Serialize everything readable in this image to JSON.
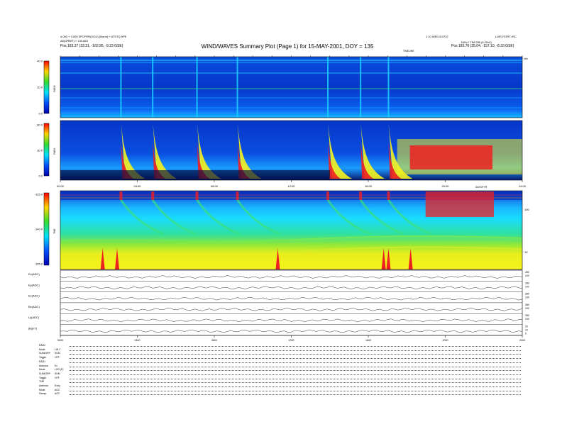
{
  "header": {
    "title": "WIND/WAVES Summary Plot (Page 1) for 15-MAY-2001, DOY = 135",
    "left_line1": "4.000 + 3.000 SPCPER(GCU) (Norm) + ATSTQ 5PE",
    "left_line2": "A5(ORBIT) = 130.663",
    "left_pos": "Pos    183.27 (33.31, -162.95, -9.23 GSE)",
    "right_line1": "1.10 WED 8.0722",
    "right_line2": "L0/EXTORT=RC",
    "right_line3": "DAILY TIM 285 (6.20x0)",
    "right_pos": "Pos    185.76 (35.04, -157.10, -8.33 GSE)",
    "timeline_label": "TIMELINE"
  },
  "panels": {
    "rad2_label": "RAD2",
    "rad1_label": "RAD1",
    "tnr_label": "TNR",
    "khz_label": "kHz",
    "rad2_ticks": [
      "40.0",
      "20.0",
      "0.0"
    ],
    "rad1_ticks": [
      "60.0",
      "30.0",
      "0.0"
    ],
    "tnr_ticks": [
      "-125.0",
      "-140.0",
      "-155.0"
    ],
    "tnr_right_ticks": [
      "100",
      "10"
    ],
    "dayofyr_label": "DAYOFYR",
    "time_ticks_top": [
      "00:00",
      "04:00",
      "08:00",
      "12:00",
      "16:00",
      "20:00",
      "24:00"
    ],
    "time_ticks_bottom": [
      "0000",
      "0400",
      "0800",
      "1200",
      "1600",
      "2000",
      "2400"
    ]
  },
  "traces": [
    {
      "label": "Ex(ADC)",
      "right": [
        "280",
        "100"
      ]
    },
    {
      "label": "Ey(ADC)",
      "right": [
        "280",
        "100"
      ]
    },
    {
      "label": "Ez(ADC)",
      "right": [
        "280",
        "100"
      ]
    },
    {
      "label": "Bx(ADC)",
      "right": [
        "280",
        "100"
      ]
    },
    {
      "label": "Ly(ADC)",
      "right": [
        "280",
        "100"
      ]
    },
    {
      "label": "|B|(nT)",
      "right": [
        "20",
        "10",
        "0"
      ]
    }
  ],
  "bottom_info": [
    {
      "label": "RAD2",
      "value": ""
    },
    {
      "label": "Mode",
      "value": "LIN 2"
    },
    {
      "label": "SUM/ORP",
      "value": "SUM"
    },
    {
      "label": "Toggle",
      "value": "OFF"
    },
    {
      "label": "RAD1",
      "value": ""
    },
    {
      "label": "Antenna",
      "value": "Ex"
    },
    {
      "label": "Mode",
      "value": "LOG (F)"
    },
    {
      "label": "SUM/ORP",
      "value": "SUM"
    },
    {
      "label": "Toggle",
      "value": "OFF"
    },
    {
      "label": "TNR",
      "value": ""
    },
    {
      "label": "Antenna",
      "value": "Exby"
    },
    {
      "label": "Mode",
      "value": "AGC"
    },
    {
      "label": "Sweep",
      "value": "AGC"
    }
  ],
  "chart_data": {
    "type": "heatmap",
    "title": "WIND/WAVES Summary Plot (Page 1) for 15-MAY-2001, DOY = 135",
    "xlabel": "",
    "x_range_hours": [
      0,
      24
    ],
    "panels": [
      {
        "name": "RAD2",
        "ylim": [
          0,
          40
        ]
      },
      {
        "name": "RAD1",
        "ylim": [
          0,
          60
        ]
      },
      {
        "name": "TNR",
        "ylim": [
          -155,
          -125
        ]
      }
    ],
    "burst_hours": [
      3.15,
      4.8,
      7.1,
      9.2,
      13.9,
      15.6,
      17.05
    ],
    "storm_hours": [
      17.5,
      24.0
    ],
    "colors": {
      "background": "#0a3ed8",
      "cyan": "#19d3ff",
      "green": "#3be07a",
      "yellow": "#f6f21c",
      "red": "#ee2020"
    }
  }
}
